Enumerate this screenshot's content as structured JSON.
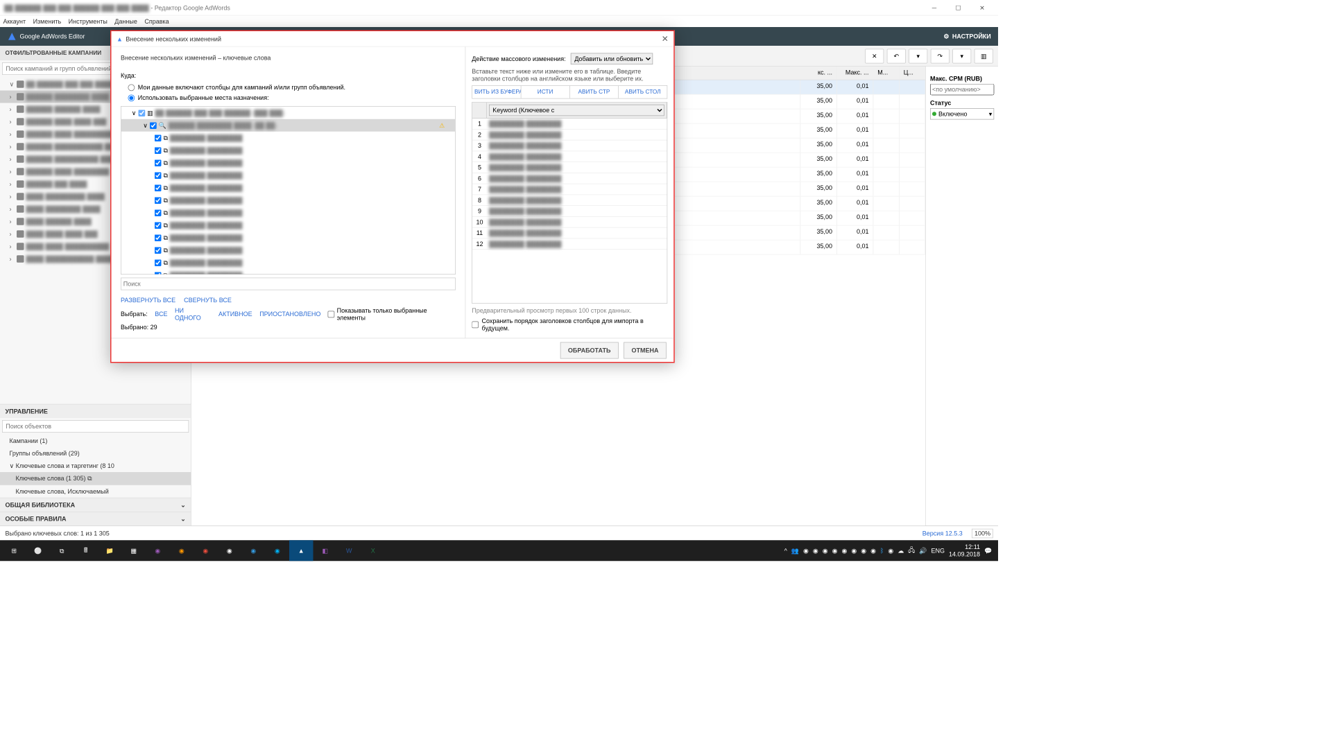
{
  "window": {
    "title_suffix": "- Редактор Google AdWords"
  },
  "menubar": [
    "Аккаунт",
    "Изменить",
    "Инструменты",
    "Данные",
    "Справка"
  ],
  "brand": "Google AdWords Editor",
  "settings_label": "НАСТРОЙКИ",
  "left": {
    "filtered_title": "ОТФИЛЬТРОВАННЫЕ КАМПАНИИ",
    "search_campaigns_ph": "Поиск кампаний и групп объявлений",
    "mgmt_title": "УПРАВЛЕНИЕ",
    "search_objects_ph": "Поиск объектов",
    "mgmt_items": {
      "campaigns": "Кампании (1)",
      "adgroups": "Группы объявлений (29)",
      "kw_targeting": "Ключевые слова и таргетинг (8 10",
      "keywords": "Ключевые слова (1 305)",
      "neg_keywords": "Ключевые слова, Исключаемый"
    },
    "lib_title": "ОБЩАЯ БИБЛИОТЕКА",
    "rules_title": "ОСОБЫЕ ПРАВИЛА"
  },
  "grid": {
    "headers": {
      "maxc1": "кс. ...",
      "maxc2": "Макс. ...",
      "m": "М...",
      "c": "Ц..."
    },
    "rows": [
      {
        "v1": "35,00",
        "v2": "0,01"
      },
      {
        "v1": "35,00",
        "v2": "0,01"
      },
      {
        "v1": "35,00",
        "v2": "0,01"
      },
      {
        "v1": "35,00",
        "v2": "0,01"
      },
      {
        "v1": "35,00",
        "v2": "0,01"
      },
      {
        "v1": "35,00",
        "v2": "0,01"
      },
      {
        "v1": "35,00",
        "v2": "0,01"
      },
      {
        "v1": "35,00",
        "v2": "0,01"
      },
      {
        "v1": "35,00",
        "v2": "0,01"
      },
      {
        "v1": "35,00",
        "v2": "0,01"
      },
      {
        "v1": "35,00",
        "v2": "0,01"
      },
      {
        "v1": "35,00",
        "v2": "0,01"
      }
    ]
  },
  "rightpanel": {
    "cpm_label": "Макс. CPM (RUB)",
    "cpm_ph": "<по умолчанию>",
    "status_label": "Статус",
    "status_value": "Включено"
  },
  "statusbar": {
    "text": "Выбрано ключевых слов: 1 из 1 305",
    "version": "Версия 12.5.3",
    "zoom": "100%"
  },
  "taskbar": {
    "lang": "ENG",
    "time": "12:11",
    "date": "14.09.2018"
  },
  "modal": {
    "title": "Внесение нескольких изменений",
    "subtitle": "Внесение нескольких изменений – ключевые слова",
    "where": "Куда:",
    "radio1": "Мои данные включают столбцы для кампаний и/или групп объявлений.",
    "radio2": "Использовать выбранные места назначения:",
    "tree_count": 12,
    "search_ph": "Поиск",
    "expand": "РАЗВЕРНУТЬ ВСЕ",
    "collapse": "СВЕРНУТЬ ВСЕ",
    "select_label": "Выбрать:",
    "sel_all": "ВСЕ",
    "sel_none": "НИ ОДНОГО",
    "sel_active": "АКТИВНОЕ",
    "sel_paused": "ПРИОСТАНОВЛЕНО",
    "show_only": "Показывать только выбранные элементы",
    "selected": "Выбрано: 29",
    "action_label": "Действие массового изменения:",
    "action_value": "Добавить или обновить",
    "paste_hint": "Вставьте текст ниже или измените его в таблице. Введите заголовки столбцов на английском языке или выберите их.",
    "btns": [
      "ВИТЬ ИЗ БУФЕРА ОБМ",
      "ИСТИ",
      "АВИТЬ СТР",
      "АВИТЬ СТОЛ"
    ],
    "kw_header": "Keyword (Ключевое с",
    "kw_rows": 12,
    "preview": "Предварительный просмотр первых 100 строк данных.",
    "save_order": "Сохранить порядок заголовков столбцов для импорта в будущем.",
    "process": "ОБРАБОТАТЬ",
    "cancel": "ОТМЕНА"
  }
}
